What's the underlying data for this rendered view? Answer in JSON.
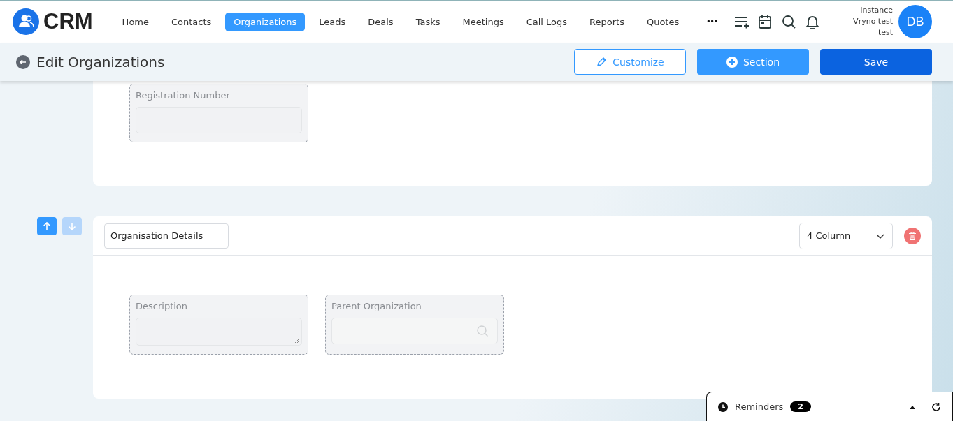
{
  "brand": {
    "name": "CRM"
  },
  "nav": [
    {
      "label": "Home",
      "selected": false
    },
    {
      "label": "Contacts",
      "selected": false
    },
    {
      "label": "Organizations",
      "selected": true
    },
    {
      "label": "Leads",
      "selected": false
    },
    {
      "label": "Deals",
      "selected": false
    },
    {
      "label": "Tasks",
      "selected": false
    },
    {
      "label": "Meetings",
      "selected": false
    },
    {
      "label": "Call Logs",
      "selected": false
    },
    {
      "label": "Reports",
      "selected": false
    },
    {
      "label": "Quotes",
      "selected": false
    }
  ],
  "more": "•••",
  "user": {
    "lines": [
      "Instance",
      "Vryno test",
      "test"
    ],
    "initials": "DB"
  },
  "page_title": "Edit Organizations",
  "actions": [
    {
      "kind": "outline",
      "label": "Customize"
    },
    {
      "kind": "add",
      "label": "Section"
    },
    {
      "kind": "primary",
      "label": "Save"
    }
  ],
  "sections": [
    {
      "fields": [
        {
          "label": "Registration Number",
          "kind": "text"
        }
      ]
    },
    {
      "title": "Organisation Details",
      "columns": "4 Column",
      "move_up_enabled": true,
      "move_down_enabled": false,
      "fields": [
        {
          "label": "Description",
          "kind": "textarea"
        },
        {
          "label": "Parent Organization",
          "kind": "lookup"
        }
      ]
    }
  ],
  "reminders": {
    "label": "Reminders",
    "count": "2"
  }
}
